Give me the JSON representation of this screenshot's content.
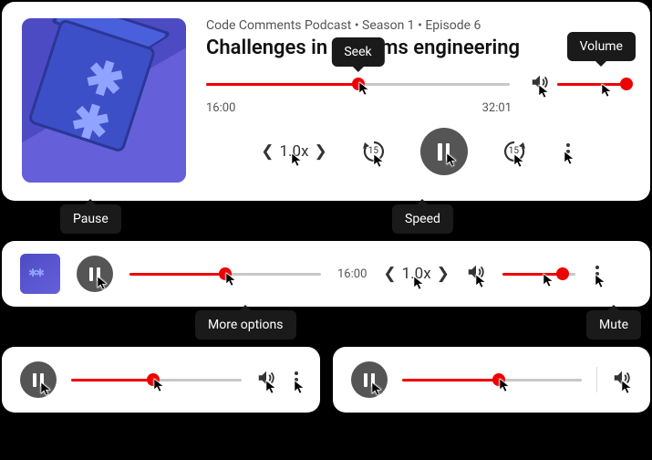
{
  "large": {
    "crumb": "Code Comments Podcast • Season 1 • Episode 6",
    "title": "Challenges in systems engineering",
    "elapsed": "16:00",
    "total": "32:01",
    "progress_pct": 50,
    "speed": "1.0x",
    "skip_seconds": "15",
    "volume_pct": 95,
    "seek_tooltip": "Seek",
    "volume_tooltip": "Volume",
    "accent": "#ee0000"
  },
  "medium": {
    "elapsed": "16:00",
    "progress_pct": 50,
    "speed": "1.0x",
    "volume_pct": 82,
    "pause_tooltip": "Pause",
    "speed_tooltip": "Speed"
  },
  "small_a": {
    "progress_pct": 48,
    "more_tooltip": "More options"
  },
  "small_b": {
    "progress_pct": 54,
    "mute_tooltip": "Mute"
  }
}
